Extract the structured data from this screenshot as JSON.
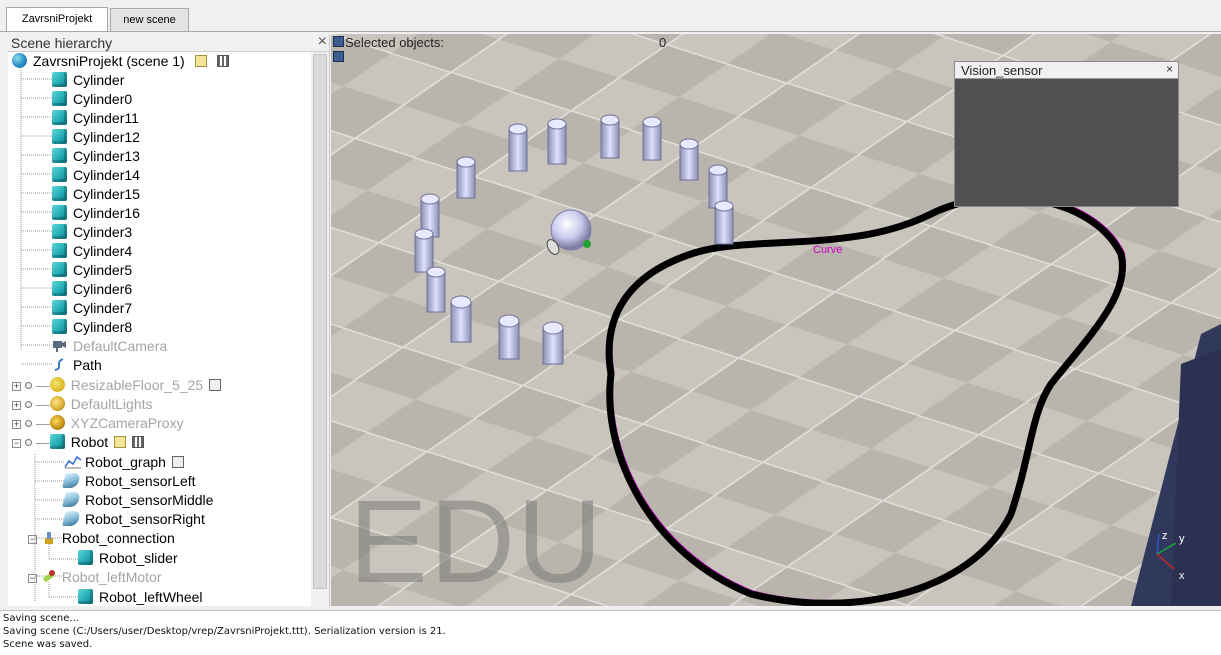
{
  "tabs": [
    {
      "label": "ZavrsniProjekt",
      "active": true
    },
    {
      "label": "new scene",
      "active": false
    }
  ],
  "hierarchy": {
    "title": "Scene hierarchy",
    "close": "×",
    "root": "ZavrsniProjekt (scene 1)",
    "items": [
      {
        "label": "Cylinder",
        "icon": "cube-icon"
      },
      {
        "label": "Cylinder0",
        "icon": "cube-icon"
      },
      {
        "label": "Cylinder11",
        "icon": "cube-icon"
      },
      {
        "label": "Cylinder12",
        "icon": "cube-icon"
      },
      {
        "label": "Cylinder13",
        "icon": "cube-icon"
      },
      {
        "label": "Cylinder14",
        "icon": "cube-icon"
      },
      {
        "label": "Cylinder15",
        "icon": "cube-icon"
      },
      {
        "label": "Cylinder16",
        "icon": "cube-icon"
      },
      {
        "label": "Cylinder3",
        "icon": "cube-icon"
      },
      {
        "label": "Cylinder4",
        "icon": "cube-icon"
      },
      {
        "label": "Cylinder5",
        "icon": "cube-icon"
      },
      {
        "label": "Cylinder6",
        "icon": "cube-icon"
      },
      {
        "label": "Cylinder7",
        "icon": "cube-icon"
      },
      {
        "label": "Cylinder8",
        "icon": "cube-icon"
      },
      {
        "label": "DefaultCamera",
        "icon": "camera-icon"
      },
      {
        "label": "Path",
        "icon": "path-icon"
      },
      {
        "label": "ResizableFloor_5_25",
        "icon": "floor-icon"
      },
      {
        "label": "DefaultLights",
        "icon": "lights-icon"
      },
      {
        "label": "XYZCameraProxy",
        "icon": "camera-proxy-icon"
      },
      {
        "label": "Robot",
        "icon": "cube-icon"
      },
      {
        "label": "Robot_graph",
        "icon": "graph-icon"
      },
      {
        "label": "Robot_sensorLeft",
        "icon": "proximity-sensor-icon"
      },
      {
        "label": "Robot_sensorMiddle",
        "icon": "proximity-sensor-icon"
      },
      {
        "label": "Robot_sensorRight",
        "icon": "proximity-sensor-icon"
      },
      {
        "label": "Robot_connection",
        "icon": "force-sensor-icon"
      },
      {
        "label": "Robot_slider",
        "icon": "cube-icon"
      },
      {
        "label": "Robot_leftMotor",
        "icon": "joint-icon"
      },
      {
        "label": "Robot_leftWheel",
        "icon": "cube-icon"
      }
    ]
  },
  "viewport": {
    "selected_label": "Selected objects:",
    "selected_count": "0",
    "curve_label": "Curve",
    "watermark": "EDU",
    "axes": {
      "z": "z",
      "y": "y",
      "x": "x"
    },
    "vision_sensor": {
      "title": "Vision_sensor",
      "close": "×"
    }
  },
  "console": {
    "lines": [
      "Saving scene...",
      "Saving scene (C:/Users/user/Desktop/vrep/ZavrsniProjekt.ttt). Serialization version is 21.",
      "Scene was saved."
    ]
  },
  "colors": {
    "path_line": "#000000",
    "path_outline": "#cc00cc",
    "accent_cube": "#1fa9b3"
  }
}
